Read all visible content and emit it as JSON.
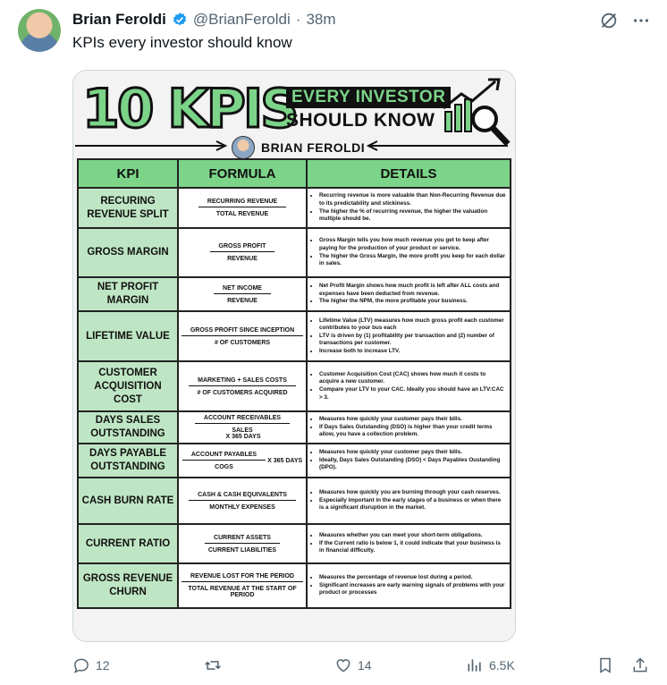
{
  "tweet": {
    "author_name": "Brian Feroldi",
    "handle": "@BrianFeroldi",
    "separator": "·",
    "time": "38m",
    "text": "KPIs every investor should know"
  },
  "infographic": {
    "title_main": "10 KPIS",
    "title_line1": "EVERY INVESTOR",
    "title_line2": "SHOULD KNOW",
    "byline": "BRIAN FEROLDI",
    "headers": {
      "kpi": "KPI",
      "formula": "FORMULA",
      "details": "DETAILS"
    },
    "rows": [
      {
        "kpi": "RECURING REVENUE SPLIT",
        "num": "RECURRING REVENUE",
        "den": "TOTAL  REVENUE",
        "suffix": "",
        "details": [
          "Recurring revenue is more valuable than Non-Recurring Revenue due to its predictability and stickiness.",
          "The higher the % of recurring revenue, the higher the valuation multiple should be."
        ]
      },
      {
        "kpi": "GROSS MARGIN",
        "num": "GROSS PROFIT",
        "den": "REVENUE",
        "suffix": "",
        "details": [
          "Gross Margin tells you how much revenue you get to keep after paying for the production of your product or service.",
          "The higher the Gross Margin, the more profit you keep for each dollar in sales."
        ]
      },
      {
        "kpi": "NET PROFIT MARGIN",
        "num": "NET INCOME",
        "den": "REVENUE",
        "suffix": "",
        "details": [
          "Net Profit Margin shows how much profit is left after ALL costs and expenses have been deducted from revenue.",
          "The higher the NPM, the more profitable your business."
        ]
      },
      {
        "kpi": "LIFETIME VALUE",
        "num": "GROSS PROFIT SINCE INCEPTION",
        "den": "# OF CUSTOMERS",
        "suffix": "",
        "details": [
          "Lifetime Value (LTV) measures how much gross profit each customer contributes to your bus each",
          "LTV is driven by (1) profitability per transaction and (2) number of transactions per customer.",
          "Increase both to increase LTV."
        ]
      },
      {
        "kpi": "CUSTOMER ACQUISITION COST",
        "num": "MARKETING + SALES COSTS",
        "den": "# OF CUSTOMERS ACQUIRED",
        "suffix": "",
        "details": [
          "Customer Acquisition Cost (CAC) shows how much it costs to acquire a new customer.",
          "Compare your LTV to your CAC. Ideally you should have an LTV:CAC > 3."
        ]
      },
      {
        "kpi": "DAYS SALES OUTSTANDING",
        "num": "ACCOUNT RECEIVABLES",
        "den": "SALES",
        "suffix": "X 365 DAYS",
        "details": [
          "Measures how quickly your customer pays their bills.",
          "If Days Sales Outstanding (DSO) is higher than your credit terms allow, you have a collection problem."
        ]
      },
      {
        "kpi": "DAYS PAYABLE OUTSTANDING",
        "num": "ACCOUNT PAYABLES",
        "den": "COGS",
        "suffix": "X 365 DAYS",
        "details": [
          "Measures how quickly your customer pays their bills.",
          "Ideally, Days Sales Outstanding (DSO) < Days Payables Oustanding (DPO)."
        ]
      },
      {
        "kpi": "CASH BURN RATE",
        "num": "CASH & CASH EQUIVALENTS",
        "den": "MONTHLY EXPENSES",
        "suffix": "",
        "details": [
          "Measures how quickly you are burning through your cash reserves.",
          "Especially important in the early stages of a business or when there is a significant disruption in the market."
        ]
      },
      {
        "kpi": "CURRENT RATIO",
        "num": "CURRENT ASSETS",
        "den": "CURRENT LIABILITIES",
        "suffix": "",
        "details": [
          "Measures whether you can meet your short-term obligations.",
          "If the Current ratio is below 1, it could indicate that your business is in financial difficulty."
        ]
      },
      {
        "kpi": "GROSS REVENUE CHURN",
        "num": "REVENUE LOST FOR THE PERIOD",
        "den": "TOTAL REVENUE AT THE START OF PERIOD",
        "suffix": "",
        "details": [
          "Measures the percentage of revenue lost during a period.",
          "Significant increases are early warning signals of problems with your product or processes"
        ]
      }
    ]
  },
  "actions": {
    "replies": "12",
    "reposts": "",
    "likes": "14",
    "views": "6.5K"
  },
  "colors": {
    "accent_green": "#7cd489",
    "light_green": "#bfe6c4",
    "muted": "#536471",
    "verified": "#1d9bf0"
  }
}
